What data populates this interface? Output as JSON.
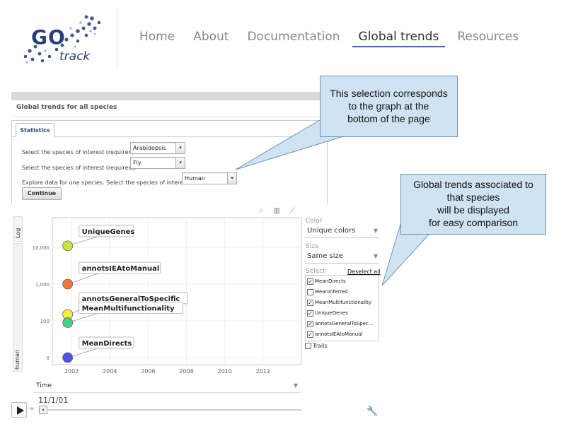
{
  "header": {
    "logo_go": "GO",
    "logo_track": "track",
    "nav": [
      {
        "label": "Home",
        "active": false
      },
      {
        "label": "About",
        "active": false
      },
      {
        "label": "Documentation",
        "active": false
      },
      {
        "label": "Global trends",
        "active": true
      },
      {
        "label": "Resources",
        "active": false
      }
    ]
  },
  "panel": {
    "title": "Global trends for all species",
    "tab": "Statistics",
    "rows": [
      {
        "label": "Select the species of interest (required):",
        "value": "Arabidopsis"
      },
      {
        "label": "Select the species of interest (required):",
        "value": "Fly"
      },
      {
        "label": "Explore data for one species. Select the species of interest:",
        "value": "Human"
      }
    ],
    "continue_label": "Continue"
  },
  "callouts": {
    "selection": [
      "This selection corresponds",
      "to the graph at the",
      "bottom of the page"
    ],
    "trends": [
      "Global trends associated to",
      "that species",
      "will be displayed",
      "for easy comparison"
    ]
  },
  "chart_controls": {
    "log_label": "Log",
    "y_axis_label": "human",
    "color_label": "Color",
    "color_value": "Unique colors",
    "size_label": "Size",
    "size_value": "Same size",
    "select_label": "Select",
    "deselect_all": "Deselect all",
    "series_select": [
      {
        "label": "MeanDirects",
        "checked": true
      },
      {
        "label": "MeanInferred",
        "checked": false
      },
      {
        "label": "MeanMultifunctionality",
        "checked": true
      },
      {
        "label": "UniqueGenes",
        "checked": true
      },
      {
        "label": "annotsGeneralToSpec...",
        "checked": true
      },
      {
        "label": "annotsIEAtoManual",
        "checked": true
      }
    ],
    "trails_label": "Trails",
    "time_label": "Time",
    "time_value": "11/1/01"
  },
  "chart_data": {
    "type": "scatter",
    "y_scale": "log",
    "x_ticks": [
      "2002",
      "2004",
      "2006",
      "2008",
      "2010",
      "2012"
    ],
    "y_ticks": [
      "0",
      "100",
      "1,000",
      "10,000"
    ],
    "xlim": [
      2001,
      2014
    ],
    "grid": true,
    "points": [
      {
        "name": "UniqueGenes",
        "x": 2001.8,
        "y": 11000,
        "color": "#c6e63a"
      },
      {
        "name": "annotsIEAtoManual",
        "x": 2001.8,
        "y": 1000,
        "color": "#ee7733"
      },
      {
        "name": "annotsGeneralToSpecific",
        "x": 2001.8,
        "y": 150,
        "color": "#f2ef35"
      },
      {
        "name": "MeanMultifunctionality",
        "x": 2001.8,
        "y": 80,
        "color": "#3ed67c"
      },
      {
        "name": "MeanDirects",
        "x": 2001.8,
        "y": 0,
        "color": "#4a55e6"
      }
    ]
  },
  "colors": {
    "callout_bg": "#cfe3f3",
    "nav_active_underline": "#3d6fa8",
    "logo": "#2a3f78"
  }
}
